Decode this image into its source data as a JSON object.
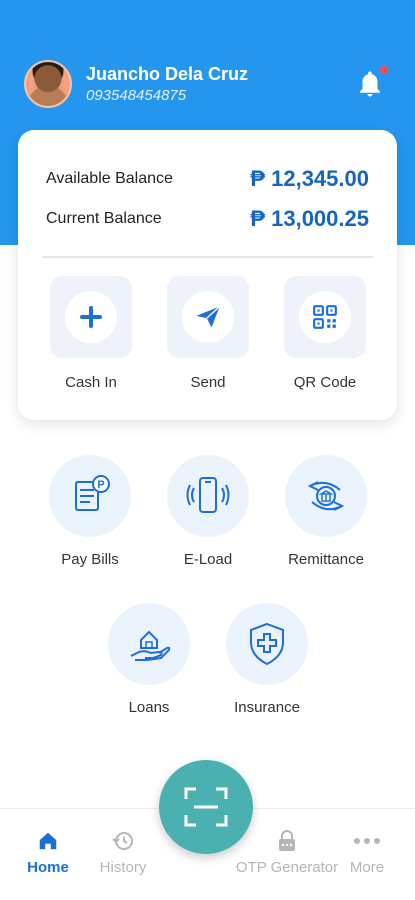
{
  "profile": {
    "name": "Juancho Dela Cruz",
    "phone": "093548454875"
  },
  "balances": {
    "available_label": "Available Balance",
    "available_value": "₱ 12,345.00",
    "current_label": "Current Balance",
    "current_value": "₱ 13,000.25"
  },
  "quick_actions": [
    {
      "label": "Cash In",
      "icon": "plus-icon"
    },
    {
      "label": "Send",
      "icon": "paper-plane-icon"
    },
    {
      "label": "QR Code",
      "icon": "qr-code-icon"
    }
  ],
  "services": [
    {
      "label": "Pay Bills",
      "icon": "bill-icon"
    },
    {
      "label": "E-Load",
      "icon": "phone-icon"
    },
    {
      "label": "Remittance",
      "icon": "remittance-icon"
    },
    {
      "label": "Loans",
      "icon": "loan-hand-house-icon"
    },
    {
      "label": "Insurance",
      "icon": "shield-cross-icon"
    }
  ],
  "nav": {
    "home": "Home",
    "history": "History",
    "otp": "OTP Generator",
    "more": "More"
  },
  "colors": {
    "primary": "#2596ee",
    "accent_blue": "#1565c0",
    "scan_button": "#4bb0b0",
    "notification_dot": "#ff4b4b"
  }
}
